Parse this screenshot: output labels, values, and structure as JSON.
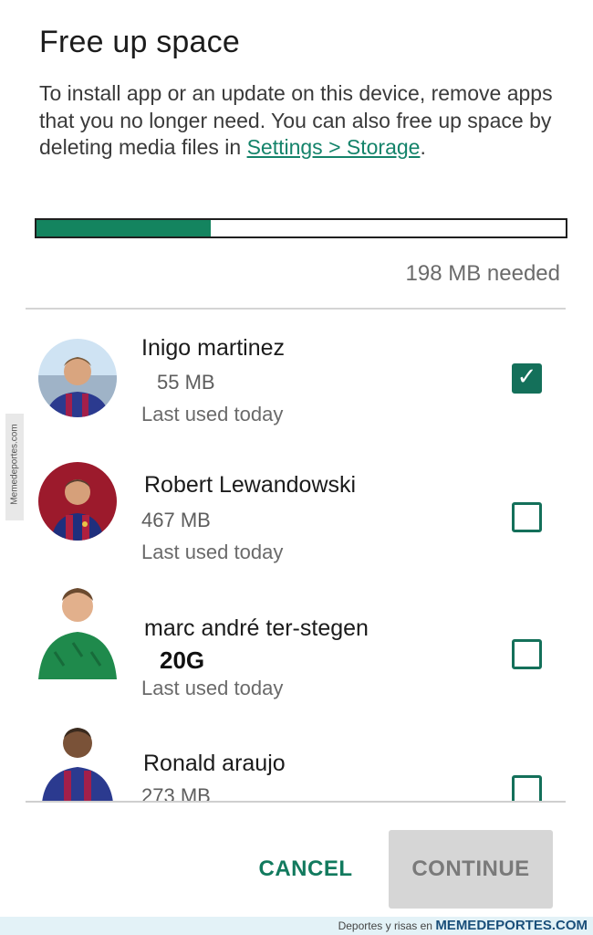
{
  "dialog": {
    "title": "Free up space",
    "description_prefix": "To install app or an update on this device, remove apps that you no longer need. You can also free up space by deleting media files in ",
    "settings_link": "Settings > Storage",
    "description_suffix": ".",
    "progress_fraction": 0.33,
    "needed_text": "198 MB needed",
    "accent_color": "#14845f"
  },
  "apps": [
    {
      "name": "Inigo martinez",
      "size": "55 MB",
      "last_used": "Last used today",
      "checked": true
    },
    {
      "name": "Robert Lewandowski",
      "size": "467 MB",
      "last_used": "Last used today",
      "checked": false
    },
    {
      "name": "marc andré ter-stegen",
      "size": "20G",
      "last_used": "Last used today",
      "checked": false
    },
    {
      "name": "Ronald araujo",
      "size": "273 MB",
      "last_used": "",
      "checked": false
    }
  ],
  "buttons": {
    "cancel": "CANCEL",
    "continue": "CONTINUE"
  },
  "watermark": {
    "side": "Memedeportes.com",
    "footer_small": "Deportes y risas en",
    "footer_brand": "MEMEDEPORTES.COM"
  }
}
